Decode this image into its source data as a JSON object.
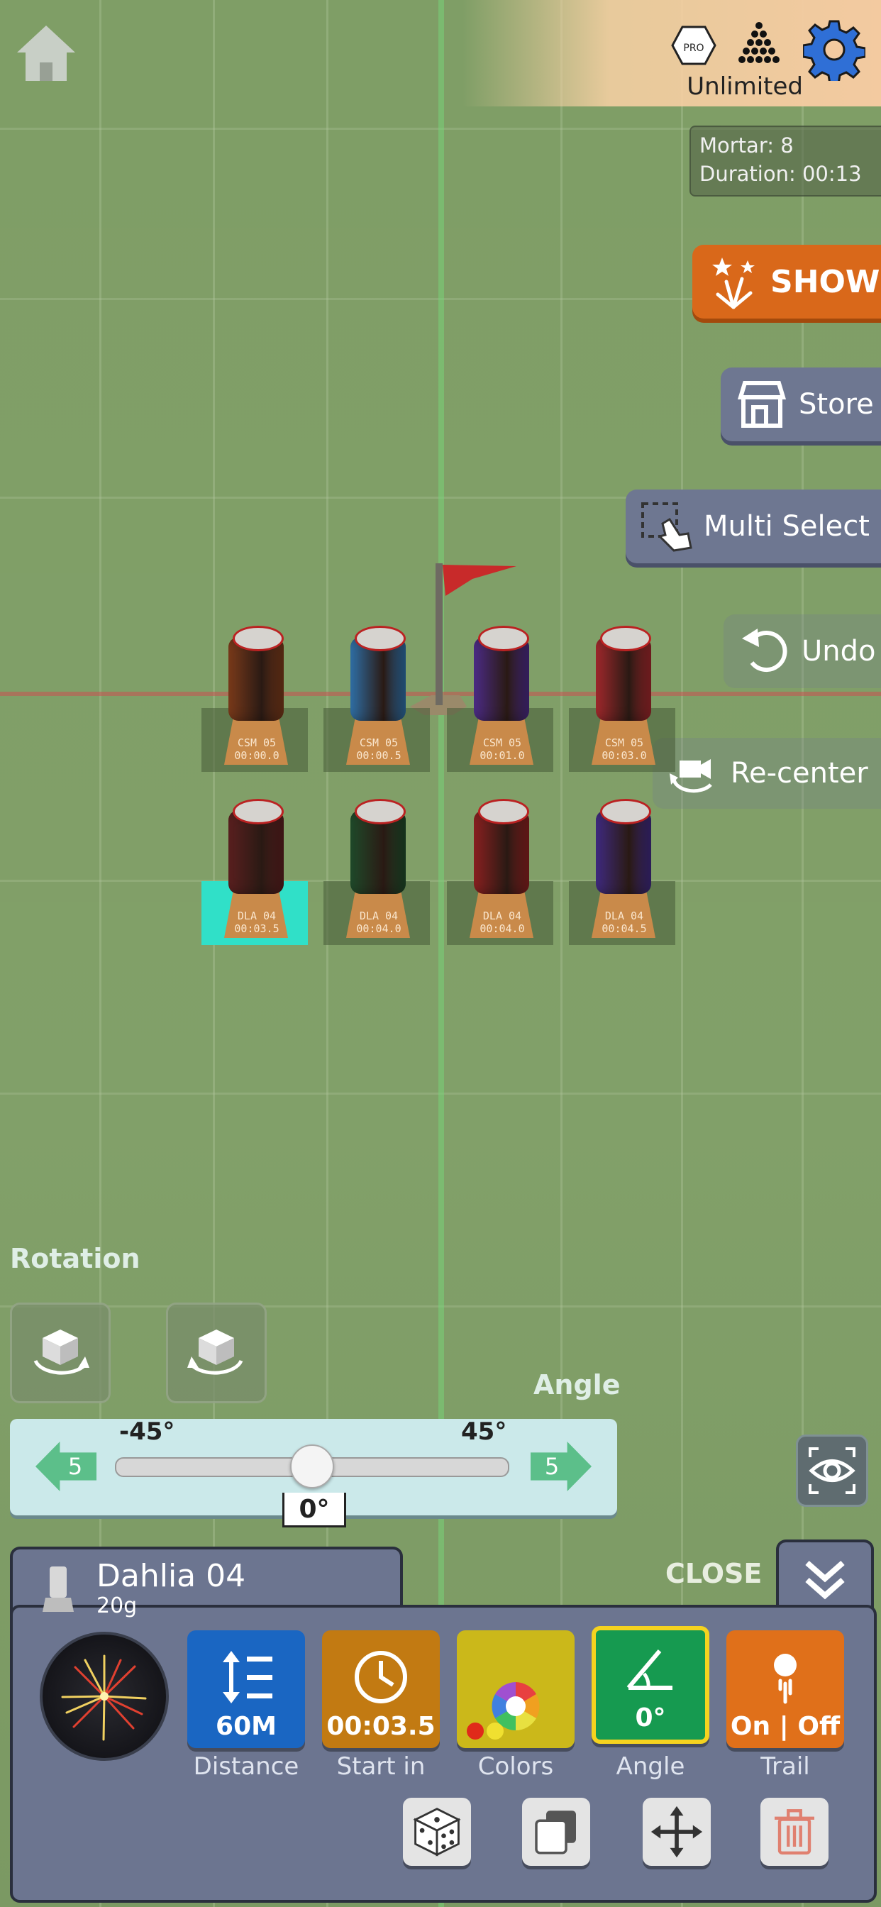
{
  "header": {
    "plan_label": "Unlimited",
    "pro_badge": "PRO"
  },
  "stats": {
    "mortar_line": "Mortar: 8",
    "duration_line": "Duration: 00:13"
  },
  "side_buttons": {
    "show": "SHOW",
    "store": "Store",
    "multi_select": "Multi Select",
    "undo": "Undo",
    "recenter": "Re-center"
  },
  "mortars": [
    {
      "code": "CSM 05",
      "time": "00:00.0",
      "color": "#7a3a1a"
    },
    {
      "code": "CSM 05",
      "time": "00:00.5",
      "color": "#2f6fa6"
    },
    {
      "code": "CSM 05",
      "time": "00:01.0",
      "color": "#4b2b86"
    },
    {
      "code": "CSM 05",
      "time": "00:03.0",
      "color": "#a0282c"
    },
    {
      "code": "DLA 04",
      "time": "00:03.5",
      "color": "#5a1f1f"
    },
    {
      "code": "DLA 04",
      "time": "00:04.0",
      "color": "#1f4a2a"
    },
    {
      "code": "DLA 04",
      "time": "00:04.0",
      "color": "#8a2020"
    },
    {
      "code": "DLA 04",
      "time": "00:04.5",
      "color": "#3f2a80"
    }
  ],
  "rotation": {
    "title": "Rotation"
  },
  "angle_control": {
    "title": "Angle",
    "min_label": "-45°",
    "max_label": "45°",
    "step_left": "5",
    "step_right": "5",
    "current_value": "0°",
    "value_fraction": 0.5
  },
  "panel": {
    "item_name": "Dahlia 04",
    "item_weight": "20g",
    "close_label": "CLOSE",
    "properties": [
      {
        "value": "60M",
        "label": "Distance",
        "color": "#1a66c2"
      },
      {
        "value": "00:03.5",
        "label": "Start in",
        "color": "#c27a12"
      },
      {
        "value": "",
        "label": "Colors",
        "color": "#cbb81a"
      },
      {
        "value": "0°",
        "label": "Angle",
        "color": "#169a50"
      },
      {
        "value": "On | Off",
        "label": "Trail",
        "color": "#e0701a"
      }
    ]
  },
  "colors": {
    "selected_highlight": "#30e0c8",
    "angle_selected_border": "#f5d31f"
  }
}
